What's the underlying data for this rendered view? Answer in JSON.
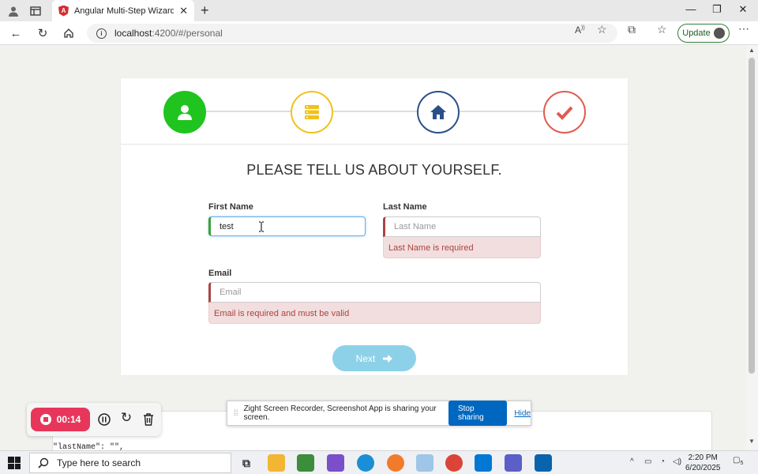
{
  "browser": {
    "tab_title": "Angular Multi-Step Wizard By ang",
    "url_host": "localhost",
    "url_path": ":4200/#/personal",
    "update_label": "Update"
  },
  "wizard": {
    "heading": "PLEASE TELL US ABOUT YOURSELF.",
    "steps": [
      {
        "icon": "user-icon",
        "color": "#1fc41f",
        "state": "active"
      },
      {
        "icon": "server-icon",
        "color": "#f0c21b",
        "state": "pending"
      },
      {
        "icon": "home-icon",
        "color": "#2b4f8a",
        "state": "pending"
      },
      {
        "icon": "check-icon",
        "color": "#e05a4f",
        "state": "pending"
      }
    ],
    "first_name": {
      "label": "First Name",
      "value": "test",
      "placeholder": "First Name"
    },
    "last_name": {
      "label": "Last Name",
      "value": "",
      "placeholder": "Last Name",
      "error": "Last Name is required"
    },
    "email": {
      "label": "Email",
      "value": "",
      "placeholder": "Email",
      "error": "Email is required and must be valid"
    },
    "next_label": "Next"
  },
  "json_preview": {
    "line": "\"lastName\": \"\","
  },
  "recorder": {
    "time": "00:14"
  },
  "share_bar": {
    "message": "Zight Screen Recorder, Screenshot App is sharing your screen.",
    "stop_label": "Stop sharing",
    "hide_label": "Hide"
  },
  "taskbar": {
    "search_placeholder": "Type here to search",
    "time": "2:20 PM",
    "date": "6/20/2025",
    "notification_count": "5"
  }
}
